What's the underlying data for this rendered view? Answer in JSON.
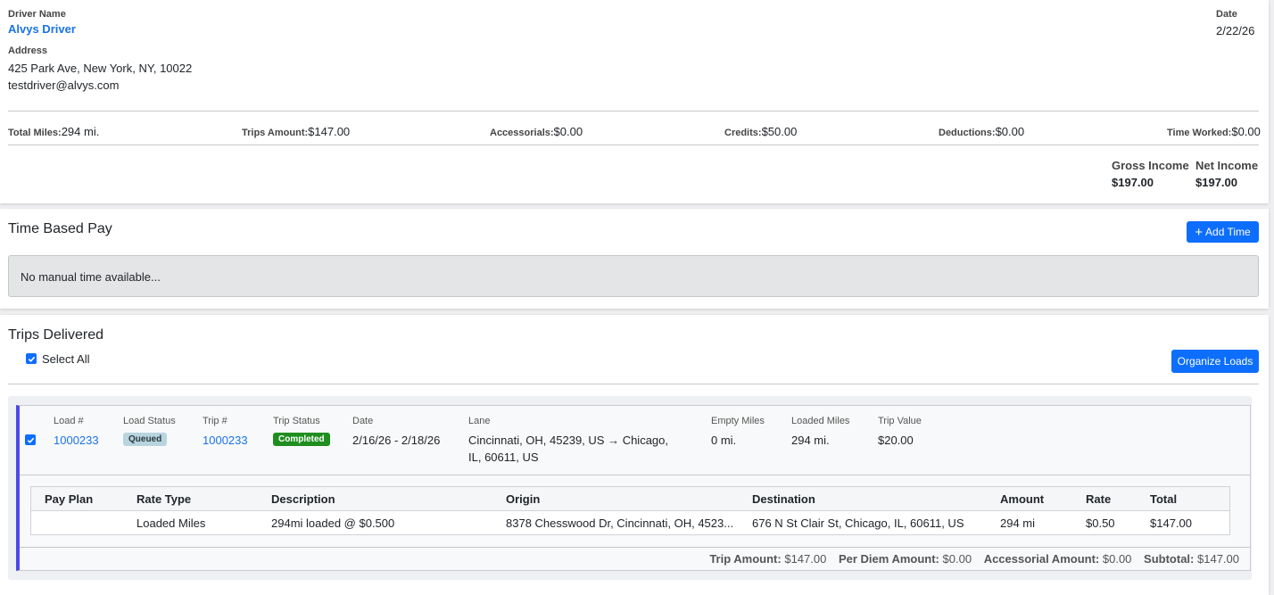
{
  "driver": {
    "name_label": "Driver Name",
    "name": "Alvys Driver",
    "address_label": "Address",
    "address": "425 Park Ave, New York, NY, 10022",
    "email": "testdriver@alvys.com",
    "date_label": "Date",
    "date": "2/22/26"
  },
  "summary": {
    "total_miles_label": "Total Miles:",
    "total_miles": "294 mi.",
    "trips_amount_label": "Trips Amount:",
    "trips_amount": "$147.00",
    "accessorials_label": "Accessorials:",
    "accessorials": "$0.00",
    "credits_label": "Credits:",
    "credits": "$50.00",
    "deductions_label": "Deductions:",
    "deductions": "$0.00",
    "time_worked_label": "Time Worked:",
    "time_worked": "$0.00",
    "gross_income_label": "Gross Income",
    "gross_income": "$197.00",
    "net_income_label": "Net Income",
    "net_income": "$197.00"
  },
  "time_based_pay": {
    "title": "Time Based Pay",
    "add_time_label": "Add Time",
    "empty_message": "No manual time available..."
  },
  "trips_delivered": {
    "title": "Trips Delivered",
    "select_all_label": "Select All",
    "organize_loads_label": "Organize Loads"
  },
  "load": {
    "headers": {
      "load_no": "Load #",
      "load_status": "Load Status",
      "trip_no": "Trip #",
      "trip_status": "Trip Status",
      "date": "Date",
      "lane": "Lane",
      "empty_miles": "Empty Miles",
      "loaded_miles": "Loaded Miles",
      "trip_value": "Trip Value"
    },
    "load_no": "1000233",
    "load_status": "Queued",
    "trip_no": "1000233",
    "trip_status": "Completed",
    "date": "2/16/26 - 2/18/26",
    "lane_line1": "Cincinnati, OH, 45239, US → Chicago,",
    "lane_line2": "IL, 60611, US",
    "empty_miles": "0 mi.",
    "loaded_miles": "294 mi.",
    "trip_value": "$20.00"
  },
  "pay_table": {
    "columns": [
      "Pay Plan",
      "Rate Type",
      "Description",
      "Origin",
      "Destination",
      "Amount",
      "Rate",
      "Total"
    ],
    "rows": [
      [
        "",
        "Loaded Miles",
        "294mi loaded @ $0.500",
        "8378 Chesswood Dr, Cincinnati, OH, 4523...",
        "676 N St Clair St, Chicago, IL, 60611, US",
        "294 mi",
        "$0.50",
        "$147.00"
      ]
    ]
  },
  "footer": {
    "trip_amount_label": "Trip Amount:",
    "trip_amount": "$147.00",
    "per_diem_label": "Per Diem Amount:",
    "per_diem": "$0.00",
    "accessorial_label": "Accessorial Amount:",
    "accessorial": "$0.00",
    "subtotal_label": "Subtotal:",
    "subtotal": "$147.00"
  },
  "colors": {
    "primary": "#0d6efd",
    "link": "#1a73e8",
    "queued_badge": "#b7d4df",
    "completed_badge": "#1e8e1e",
    "row_accent": "#4a4ae8"
  }
}
